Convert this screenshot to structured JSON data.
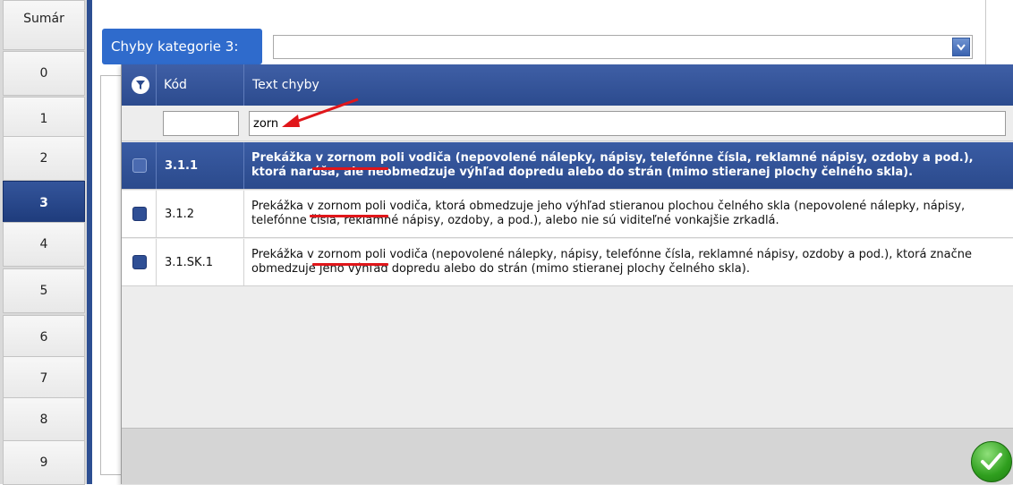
{
  "sidebar": {
    "items": [
      {
        "label": "Sumár",
        "active": false
      },
      {
        "label": "0",
        "active": false
      },
      {
        "label": "1",
        "active": false
      },
      {
        "label": "2",
        "active": false
      },
      {
        "label": "3",
        "active": true
      },
      {
        "label": "4",
        "active": false
      },
      {
        "label": "5",
        "active": false
      },
      {
        "label": "6",
        "active": false
      },
      {
        "label": "7",
        "active": false
      },
      {
        "label": "8",
        "active": false
      },
      {
        "label": "9",
        "active": false
      }
    ]
  },
  "category": {
    "label": "Chyby kategorie 3:",
    "selected_value": ""
  },
  "grid": {
    "headers": {
      "code": "Kód",
      "text": "Text chyby"
    },
    "filter": {
      "code_value": "",
      "text_value": "zorn"
    },
    "rows": [
      {
        "code": "3.1.1",
        "text": "Prekážka v zornom poli vodiča (nepovolené nálepky, nápisy, telefónne čísla, reklamné nápisy, ozdoby a pod.), ktorá narúša, ale neobmedzuje výhľad dopredu alebo do strán (mimo stieranej plochy čelného skla).",
        "selected": true
      },
      {
        "code": "3.1.2",
        "text": "Prekážka v zornom poli vodiča, ktorá obmedzuje jeho výhľad stieranou plochou čelného skla (nepovolené nálepky, nápisy, telefónne čísla, reklamné nápisy, ozdoby, a pod.), alebo nie sú viditeľné vonkajšie zrkadlá.",
        "selected": false
      },
      {
        "code": "3.1.SK.1",
        "text": "Prekážka v zornom poli vodiča (nepovolené nálepky, nápisy, telefónne čísla, reklamné nápisy, ozdoby a pod.), ktorá značne obmedzuje jeho výhľad dopredu alebo do strán (mimo stieranej plochy čelného skla).",
        "selected": false
      }
    ]
  },
  "colors": {
    "accent": "#2f6bcc",
    "header_bg": "#2c4b8e",
    "highlight_underline": "#e0161a",
    "ok_green": "#2f9f1e"
  },
  "icons": {
    "filter": "filter-icon",
    "dropdown": "chevron-down-icon",
    "confirm": "check-icon",
    "annotation": "red-arrow"
  }
}
